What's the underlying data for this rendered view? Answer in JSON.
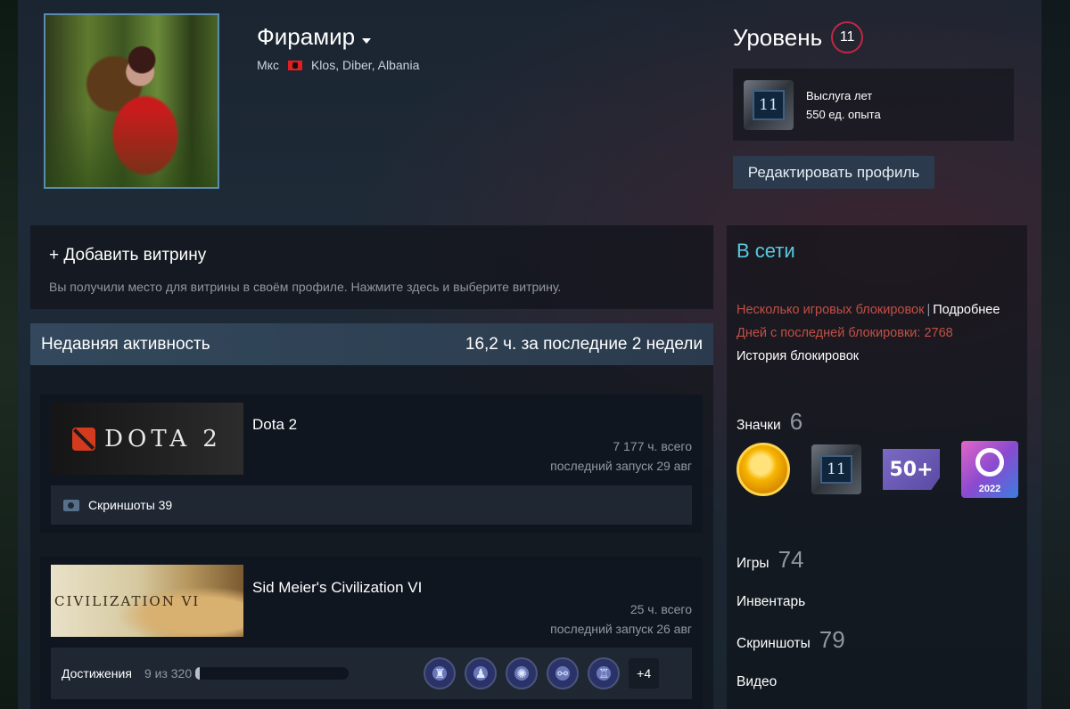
{
  "profile": {
    "username": "Фирамир",
    "real_name": "Мкс",
    "location": "Klos, Diber, Albania"
  },
  "level": {
    "title": "Уровень",
    "value": "11",
    "badge_number": "11",
    "badge_name": "Выслуга лет",
    "badge_xp": "550 ед. опыта",
    "edit_profile": "Редактировать профиль"
  },
  "showcase": {
    "title": "+ Добавить витрину",
    "desc": "Вы получили место для витрины в своём профиле. Нажмите здесь и выберите витрину."
  },
  "activity": {
    "title": "Недавняя активность",
    "hours_summary": "16,2 ч. за последние 2 недели",
    "games": [
      {
        "name": "Dota 2",
        "capsule_text": "DOTA 2",
        "hours_total": "7 177 ч. всего",
        "last_played": "последний запуск 29 авг",
        "screenshots": "Скриншоты 39"
      },
      {
        "name": "Sid Meier's Civilization VI",
        "capsule_text": "CIVILIZATION VI",
        "hours_total": "25 ч. всего",
        "last_played": "последний запуск 26 авг",
        "achievements_label": "Достижения",
        "achievements_count": "9 из 320",
        "achievements_progress": 0.028,
        "achievements_more": "+4"
      }
    ]
  },
  "sidebar": {
    "status": "В сети",
    "ban_text": "Несколько игровых блокировок",
    "ban_link": "Подробнее",
    "days_since_ban": "Дней с последней блокировки: 2768",
    "ban_history": "История блокировок",
    "badges_label": "Значки",
    "badges_count": "6",
    "badge_level_number": "11",
    "badge_50": "50+",
    "badge_year": "2022",
    "games_label": "Игры",
    "games_count": "74",
    "inventory_label": "Инвентарь",
    "screenshots_label": "Скриншоты",
    "screenshots_count": "79",
    "videos_label": "Видео"
  },
  "colors": {
    "status": "#57cbde",
    "ban": "#c15044",
    "level_ring": "#c02942"
  }
}
